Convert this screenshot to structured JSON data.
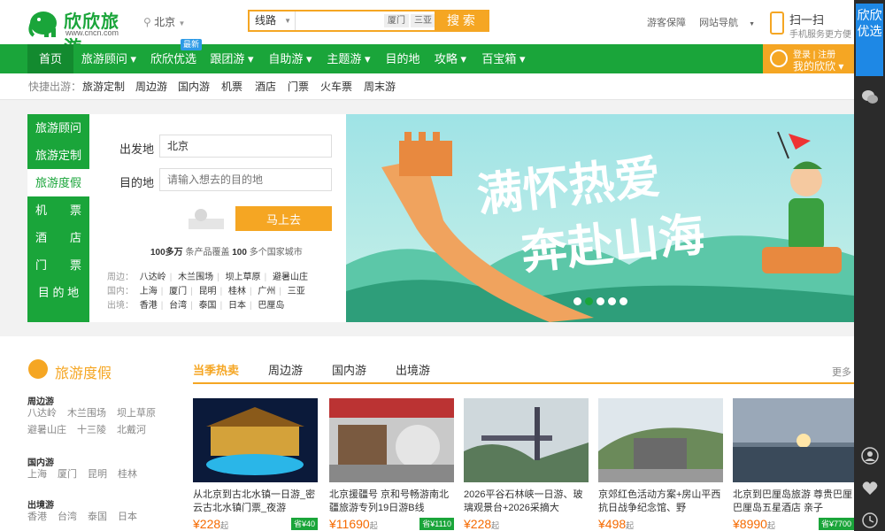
{
  "header": {
    "logo_text": "欣欣旅游",
    "logo_url": "www.cncn.com",
    "city": "北京",
    "search": {
      "type": "线路",
      "placeholder": "",
      "tags": [
        "厦门",
        "三亚"
      ],
      "button": "搜 索"
    },
    "links": [
      "游客保障",
      "网站导航"
    ],
    "scan_title": "扫一扫",
    "scan_sub": "手机服务更方便"
  },
  "nav": {
    "items": [
      "首页",
      "旅游顾问",
      "欣欣优选",
      "跟团游",
      "自助游",
      "主题游",
      "目的地",
      "攻略",
      "百宝箱"
    ],
    "new_badge": "最新",
    "login_line1": "登录 | 注册",
    "login_line2": "我的欣欣"
  },
  "quick": {
    "label": "快捷出游：",
    "items": [
      "旅游定制",
      "周边游",
      "国内游",
      "机票",
      "酒店",
      "门票",
      "火车票",
      "周末游"
    ]
  },
  "sidemenu": [
    "旅游顾问",
    "旅游定制",
    "旅游度假",
    "机　　票",
    "酒　　店",
    "门　　票",
    "目 的 地"
  ],
  "form": {
    "from_label": "出发地",
    "from_value": "北京",
    "to_label": "目的地",
    "to_placeholder": "请输入想去的目的地",
    "button": "马上去",
    "stat_a": "100多万",
    "stat_b": "条产品覆盖",
    "stat_c": "100",
    "stat_d": "多个国家城市",
    "quick_rows": [
      {
        "label": "周边：",
        "items": [
          "八达岭",
          "木兰围场",
          "坝上草原",
          "避暑山庄"
        ]
      },
      {
        "label": "国内：",
        "items": [
          "上海",
          "厦门",
          "昆明",
          "桂林",
          "广州",
          "三亚"
        ]
      },
      {
        "label": "出境：",
        "items": [
          "香港",
          "台湾",
          "泰国",
          "日本",
          "巴厘岛"
        ]
      }
    ]
  },
  "banner": {
    "slogan_line1": "满怀热爱",
    "slogan_line2": "奔赴山海"
  },
  "section": {
    "title": "旅游度假",
    "tabs": [
      "当季热卖",
      "周边游",
      "国内游",
      "出境游"
    ],
    "more": "更多"
  },
  "categories": [
    {
      "name": "周边游",
      "links": [
        "八达岭",
        "木兰围场",
        "坝上草原",
        "避暑山庄",
        "十三陵",
        "北戴河"
      ]
    },
    {
      "name": "国内游",
      "links": [
        "上海",
        "厦门",
        "昆明",
        "桂林"
      ]
    },
    {
      "name": "出境游",
      "links": [
        "香港",
        "台湾",
        "泰国",
        "日本"
      ]
    }
  ],
  "products": [
    {
      "title": "从北京到古北水镇一日游_密云古北水镇门票_夜游",
      "price": "¥228",
      "unit": "起",
      "save": "省¥40"
    },
    {
      "title": "北京援疆号 京和号畅游南北疆旅游专列19日游B线",
      "price": "¥11690",
      "unit": "起",
      "save": "省¥1110"
    },
    {
      "title": "2026平谷石林峡一日游、玻璃观景台+2026采摘大",
      "price": "¥228",
      "unit": "起",
      "save": ""
    },
    {
      "title": "京郊红色活动方案+房山平西抗日战争纪念馆、野",
      "price": "¥498",
      "unit": "起",
      "save": ""
    },
    {
      "title": "北京到巴厘岛旅游 尊贵巴厘 巴厘岛五星酒店 亲子",
      "price": "¥8990",
      "unit": "起",
      "save": "省¥7700"
    }
  ],
  "rightbar": {
    "label": "欣欣优选"
  }
}
